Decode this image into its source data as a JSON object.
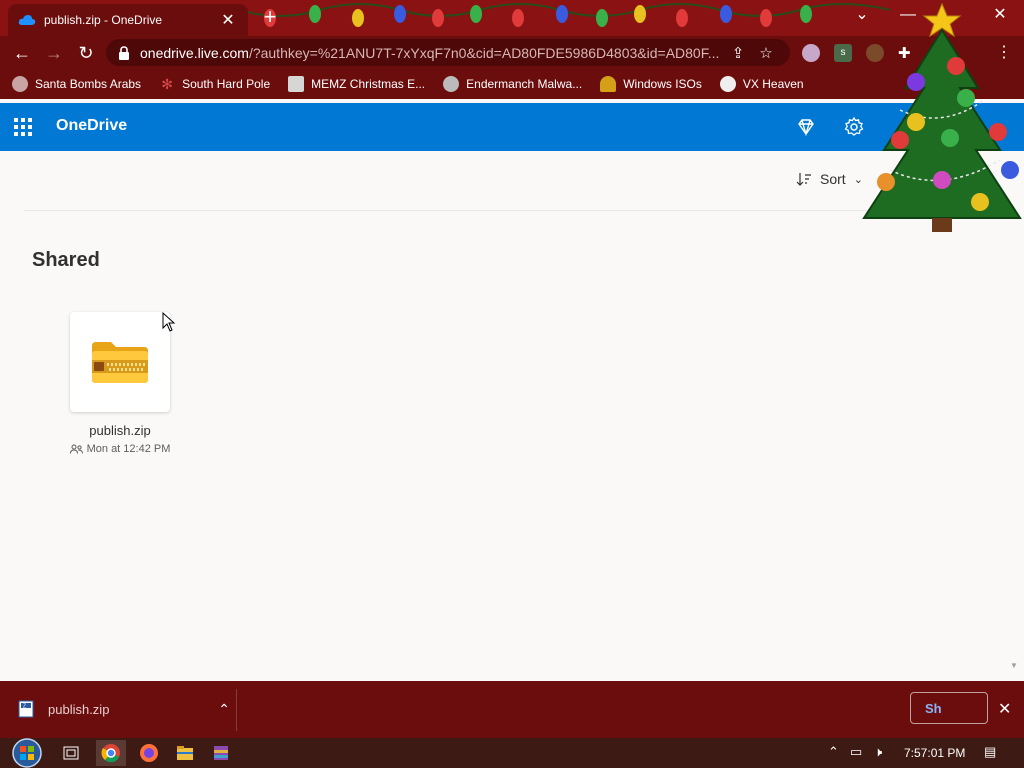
{
  "browser": {
    "tab_title": "publish.zip - OneDrive",
    "url_host": "onedrive.live.com",
    "url_rest": "/?authkey=%21ANU7T-7xYxqF7n0&cid=AD80FDE5986D4803&id=AD80F...",
    "tab_close_icon": "close-icon",
    "new_tab_icon": "plus-icon"
  },
  "bookmarks": [
    {
      "label": "Santa Bombs Arabs",
      "icon": "globe-icon",
      "color": "#c9a4a4"
    },
    {
      "label": "South Hard Pole",
      "icon": "snowflake-icon",
      "color": "#d94a4a"
    },
    {
      "label": "MEMZ Christmas E...",
      "icon": "page-icon",
      "color": "#d6d6d6"
    },
    {
      "label": "Endermanch Malwa...",
      "icon": "raccoon-icon",
      "color": "#bbbbbb"
    },
    {
      "label": "Windows ISOs",
      "icon": "person-icon",
      "color": "#d4a017"
    },
    {
      "label": "VX Heaven",
      "icon": "radiation-icon",
      "color": "#eeeeee"
    }
  ],
  "onedrive": {
    "app_name": "OneDrive",
    "sort_label": "Sort",
    "section_title": "Shared",
    "accent": "#0078d4"
  },
  "files": [
    {
      "name": "publish.zip",
      "meta": "Mon at 12:42 PM",
      "icon": "zip-folder-icon"
    }
  ],
  "downloads": {
    "item_name": "publish.zip",
    "show_all_label": "Sh"
  },
  "taskbar": {
    "clock": "7:57:01 PM"
  },
  "colors": {
    "chrome_dark": "#6c0d0d",
    "chrome_title": "#8a1212",
    "page_bg": "#faf9f8"
  }
}
